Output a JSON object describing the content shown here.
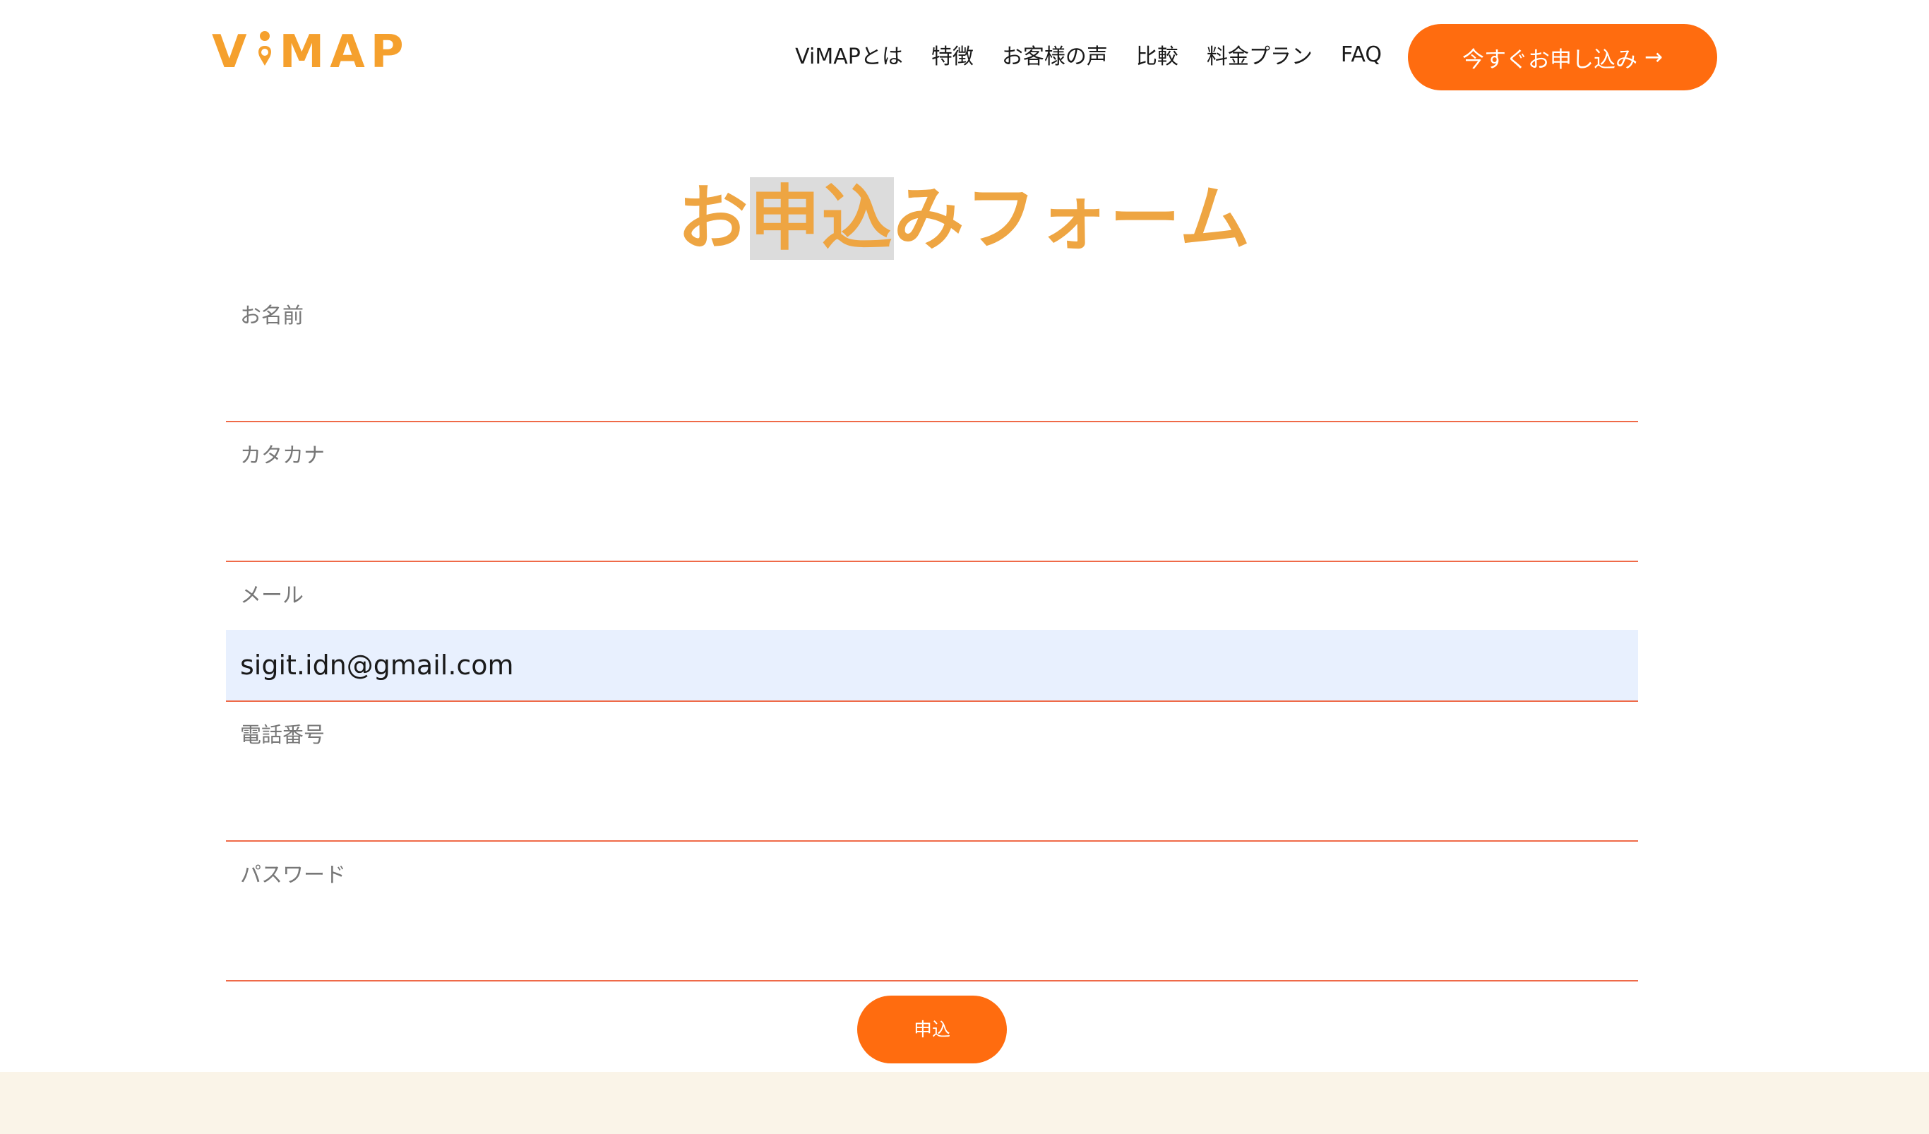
{
  "header": {
    "logo": {
      "text_before": "V",
      "text_after": "MAP",
      "color": "#f5a02d"
    },
    "nav": [
      {
        "label": "ViMAPとは"
      },
      {
        "label": "特徴"
      },
      {
        "label": "お客様の声"
      },
      {
        "label": "比較"
      },
      {
        "label": "料金プラン"
      },
      {
        "label": "FAQ"
      }
    ],
    "cta_label": "今すぐお申し込み",
    "cta_arrow": "→"
  },
  "main": {
    "title_parts": [
      "お",
      "申込",
      "みフォーム"
    ]
  },
  "form": {
    "fields": [
      {
        "label": "お名前",
        "value": ""
      },
      {
        "label": "カタカナ",
        "value": ""
      },
      {
        "label": "メール",
        "value": "sigit.idn@gmail.com"
      },
      {
        "label": "電話番号",
        "value": ""
      },
      {
        "label": "パスワード",
        "value": ""
      }
    ],
    "submit_label": "申込"
  },
  "colors": {
    "accent": "#ff6c0f",
    "title": "#eea542",
    "field_line": "#ef6a48",
    "autofill_bg": "#e8f0fe",
    "footer_bg": "#faf4e8"
  }
}
